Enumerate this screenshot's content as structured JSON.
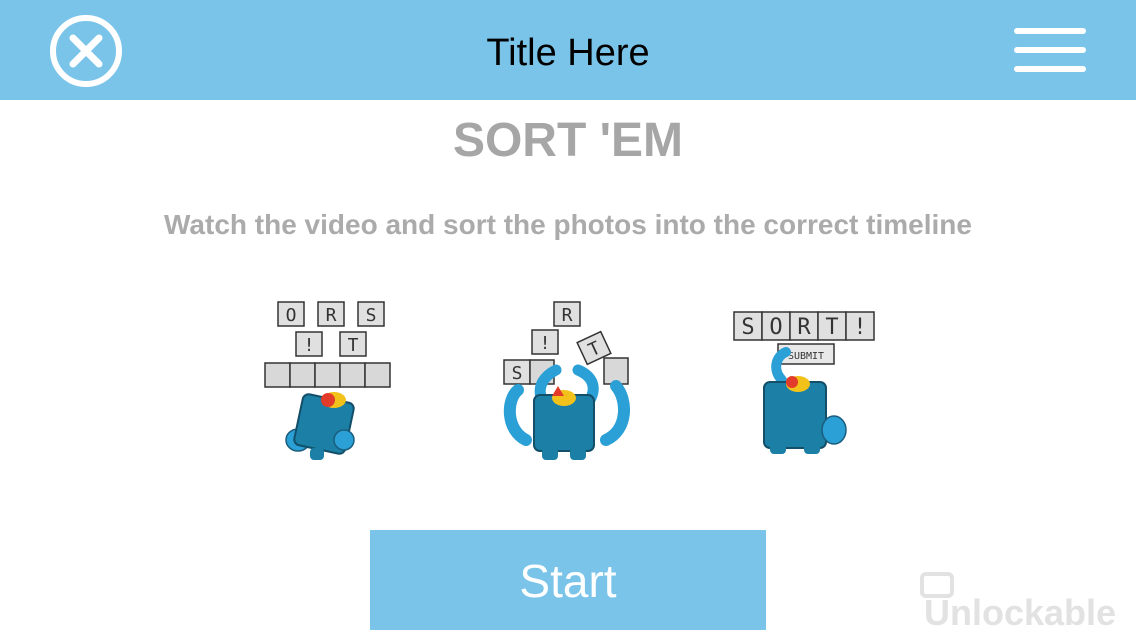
{
  "header": {
    "title": "Title Here",
    "close_icon": "close-circle-icon",
    "menu_icon": "hamburger-menu-icon",
    "background": "#7ac4ea"
  },
  "game": {
    "title": "SORT 'EM",
    "instructions": "Watch the video and sort the photos into the correct timeline"
  },
  "illustrations": [
    {
      "tiles": [
        "O",
        "R",
        "S",
        "!",
        "T"
      ]
    },
    {
      "tiles": [
        "R",
        "!",
        "S",
        "T"
      ]
    },
    {
      "tiles": [
        "S",
        "O",
        "R",
        "T",
        "!"
      ],
      "submit_label": "SUBMIT"
    }
  ],
  "start_button": {
    "label": "Start",
    "color": "#7ac4ea"
  },
  "watermark": {
    "text": "Unlockable"
  }
}
